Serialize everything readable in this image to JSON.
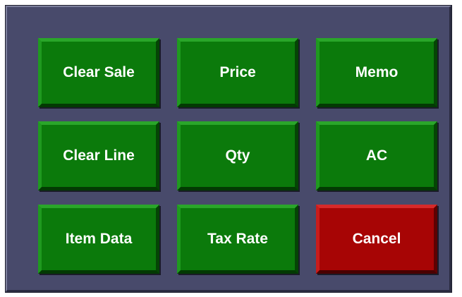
{
  "keypad": {
    "keys": [
      {
        "label": "Clear Sale",
        "color": "#0b7a0b"
      },
      {
        "label": "Price",
        "color": "#0b7a0b"
      },
      {
        "label": "Memo",
        "color": "#0b7a0b"
      },
      {
        "label": "Clear Line",
        "color": "#0b7a0b"
      },
      {
        "label": "Qty",
        "color": "#0b7a0b"
      },
      {
        "label": "AC",
        "color": "#0b7a0b"
      },
      {
        "label": "Item Data",
        "color": "#0b7a0b"
      },
      {
        "label": "Tax Rate",
        "color": "#0b7a0b"
      },
      {
        "label": "Cancel",
        "color": "#a70505"
      }
    ]
  },
  "panel_color": "#484a6b"
}
